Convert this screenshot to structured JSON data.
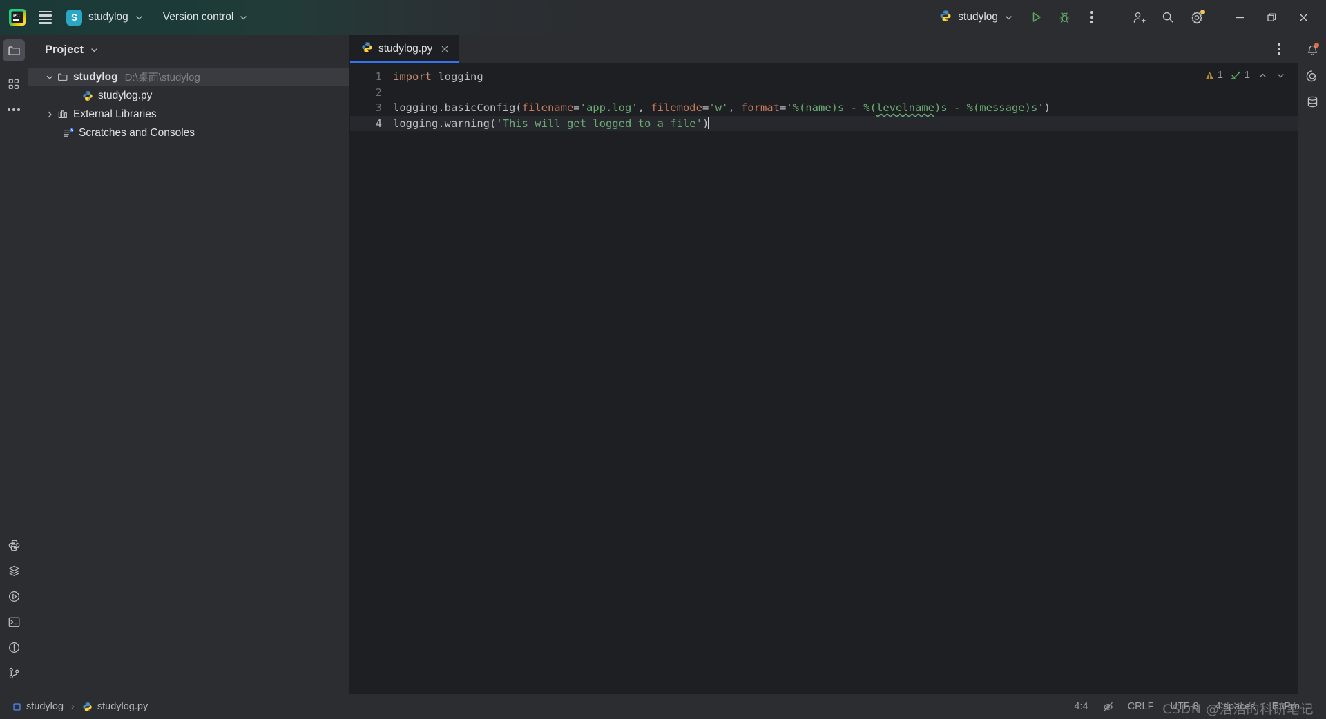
{
  "titlebar": {
    "logo_icon": "pycharm-logo-icon",
    "menu_icon": "hamburger-menu-icon",
    "project_badge": "S",
    "project_name": "studylog",
    "version_control_label": "Version control",
    "run_config_name": "studylog",
    "run_icon": "run-play-icon",
    "debug_icon": "debug-bug-icon",
    "more_icon": "more-vertical-icon",
    "add_user_icon": "add-user-icon",
    "search_icon": "search-icon",
    "settings_icon": "settings-gear-icon",
    "settings_badge_color": "#f2c55c",
    "minimize_icon": "minimize-icon",
    "maximize_icon": "maximize-restore-icon",
    "close_icon": "close-icon"
  },
  "left_rail": {
    "items": [
      {
        "name": "project-tool-window",
        "icon": "folder-icon",
        "active": true
      },
      {
        "name": "structure-tool-window",
        "icon": "structure-icon",
        "active": false
      },
      {
        "name": "more-tool-windows",
        "icon": "ellipsis-icon",
        "active": false
      }
    ],
    "bottom_items": [
      {
        "name": "python-packages",
        "icon": "python-icon"
      },
      {
        "name": "python-console-stack",
        "icon": "layers-icon"
      },
      {
        "name": "run-tool-window",
        "icon": "run-circle-icon"
      },
      {
        "name": "terminal-tool-window",
        "icon": "terminal-icon"
      },
      {
        "name": "problems-tool-window",
        "icon": "warning-circle-icon"
      },
      {
        "name": "version-control-tool-window",
        "icon": "git-branch-icon"
      }
    ]
  },
  "project_panel": {
    "title": "Project",
    "title_chevron": "chevron-down-icon",
    "tree": [
      {
        "label": "studylog",
        "path": "D:\\桌面\\studylog",
        "icon": "folder-icon",
        "arrow": "chevron-down-icon",
        "depth": 0,
        "bold": true,
        "selected": true
      },
      {
        "label": "studylog.py",
        "path": "",
        "icon": "python-file-icon",
        "arrow": "",
        "depth": 1,
        "bold": false,
        "selected": false
      },
      {
        "label": "External Libraries",
        "path": "",
        "icon": "library-icon",
        "arrow": "chevron-right-icon",
        "depth": 0,
        "bold": false,
        "selected": false
      },
      {
        "label": "Scratches and Consoles",
        "path": "",
        "icon": "scratches-icon",
        "arrow": "",
        "depth": 0,
        "bold": false,
        "selected": false
      }
    ]
  },
  "editor": {
    "tab": {
      "label": "studylog.py",
      "icon": "python-file-icon",
      "close_icon": "close-icon",
      "active": true
    },
    "tab_options_icon": "more-vertical-icon",
    "inspections": {
      "warning_icon": "warning-triangle-icon",
      "warning_count": "1",
      "ok_icon": "inspection-check-icon",
      "ok_count": "1",
      "prev_icon": "chevron-up-icon",
      "next_icon": "chevron-down-icon"
    },
    "lines": [
      {
        "num": "1",
        "current": false,
        "tokens": [
          {
            "t": "import",
            "c": "k-import"
          },
          {
            "t": " logging",
            "c": "k-plain"
          }
        ]
      },
      {
        "num": "2",
        "current": false,
        "tokens": []
      },
      {
        "num": "3",
        "current": false,
        "tokens": [
          {
            "t": "logging.basicConfig(",
            "c": "k-plain"
          },
          {
            "t": "filename",
            "c": "k-kwarg"
          },
          {
            "t": "=",
            "c": "k-plain"
          },
          {
            "t": "'app.log'",
            "c": "k-str"
          },
          {
            "t": ", ",
            "c": "k-plain"
          },
          {
            "t": "filemode",
            "c": "k-kwarg"
          },
          {
            "t": "=",
            "c": "k-plain"
          },
          {
            "t": "'w'",
            "c": "k-str"
          },
          {
            "t": ", ",
            "c": "k-plain"
          },
          {
            "t": "format",
            "c": "k-kwarg"
          },
          {
            "t": "=",
            "c": "k-plain"
          },
          {
            "t": "'%(name)s - %(",
            "c": "k-str"
          },
          {
            "t": "levelname",
            "c": "k-str typo"
          },
          {
            "t": ")s - %(message)s'",
            "c": "k-str"
          },
          {
            "t": ")",
            "c": "k-plain"
          }
        ]
      },
      {
        "num": "4",
        "current": true,
        "tokens": [
          {
            "t": "logging.warning(",
            "c": "k-plain"
          },
          {
            "t": "'This will get logged to a file'",
            "c": "k-str"
          },
          {
            "t": ")",
            "c": "k-plain"
          }
        ]
      }
    ]
  },
  "right_rail": {
    "items": [
      {
        "name": "notifications",
        "icon": "bell-icon",
        "badge": true
      },
      {
        "name": "ai-assistant",
        "icon": "ai-spiral-icon",
        "badge": false
      },
      {
        "name": "database-tool-window",
        "icon": "database-icon",
        "badge": false
      }
    ]
  },
  "status_bar": {
    "breadcrumbs": [
      {
        "label": "studylog",
        "icon": "module-icon"
      },
      {
        "label": "studylog.py",
        "icon": "python-file-icon"
      }
    ],
    "separator": "›",
    "caret_position": "4:4",
    "inspection_widget_icon": "inspections-eye-off-icon",
    "line_separator": "CRLF",
    "encoding": "UTF-8",
    "indent": "4 spaces",
    "interpreter": "E:\\Pro...",
    "watermark": "CSDN @浩浩的科研笔记"
  }
}
